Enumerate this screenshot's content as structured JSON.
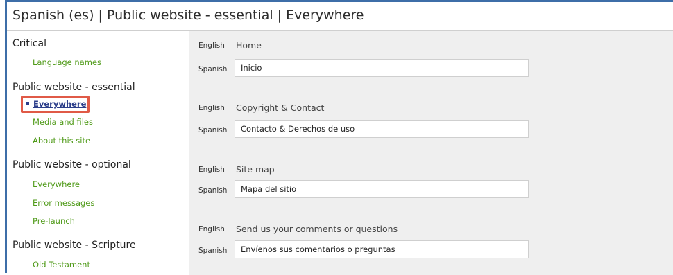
{
  "header": {
    "title": "Spanish (es) | Public website - essential | Everywhere"
  },
  "sidebar": {
    "sections": [
      {
        "heading": "Critical",
        "items": [
          "Language names"
        ]
      },
      {
        "heading": "Public website - essential",
        "items": [
          "Everywhere",
          "Media and files",
          "About this site"
        ]
      },
      {
        "heading": "Public website - optional",
        "items": [
          "Everywhere",
          "Error messages",
          "Pre-launch"
        ]
      },
      {
        "heading": "Public website - Scripture",
        "items": [
          "Old Testament"
        ]
      }
    ],
    "active_item": "Everywhere"
  },
  "main": {
    "source_language_label": "English",
    "target_language_label": "Spanish",
    "entries": [
      {
        "english": "Home",
        "spanish": "Inicio"
      },
      {
        "english": "Copyright & Contact",
        "spanish": "Contacto & Derechos de uso"
      },
      {
        "english": "Site map",
        "spanish": "Mapa del sitio"
      },
      {
        "english": "Send us your comments or questions",
        "spanish": "Envíenos sus comentarios o preguntas"
      }
    ]
  },
  "colors": {
    "frame_border": "#3d6ea8",
    "link_green": "#4f9a18",
    "active_link": "#2c3e8a",
    "highlight_box": "#e05a47",
    "panel_bg": "#efefef"
  }
}
